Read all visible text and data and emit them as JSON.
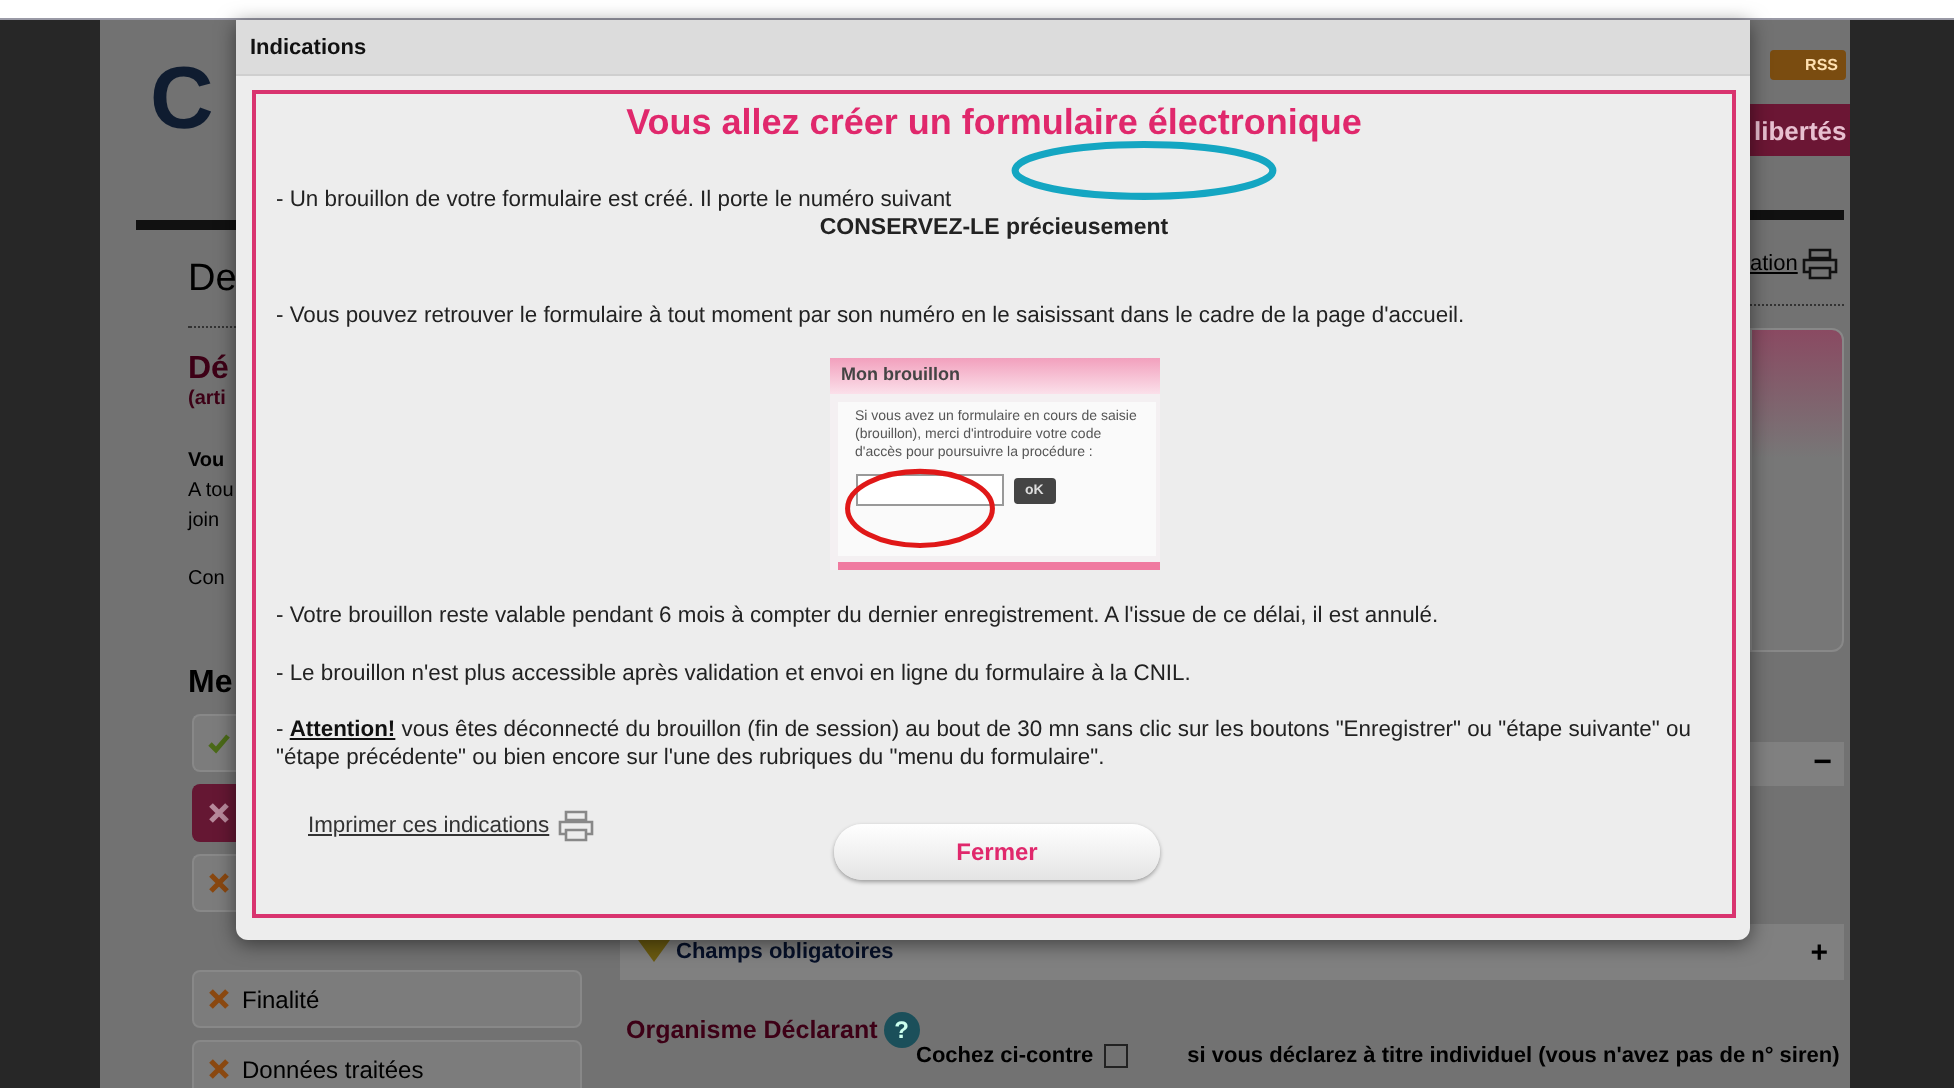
{
  "background_page": {
    "logo_fragment": "C",
    "rss_badge": "RSS",
    "banner_fragment": "libertés",
    "page_title_fragment": "De",
    "print_link_fragment": "ation",
    "section_title_fragment": "Dé",
    "section_subtitle_fragment": "(arti",
    "text_fragments": [
      {
        "text": "Vou",
        "kind": "bold"
      },
      {
        "text": "A tou",
        "kind": "plain"
      },
      {
        "text": "join",
        "kind": "plain"
      },
      {
        "text": "Con",
        "kind": "plain"
      }
    ],
    "menu_title_fragment": "Me",
    "menu_items": [
      {
        "kind": "done",
        "selected": false
      },
      {
        "kind": "todo",
        "selected": true
      },
      {
        "kind": "todo",
        "selected": false
      },
      {
        "label": "Finalité",
        "kind": "todo",
        "selected": false
      },
      {
        "label": "Données traitées",
        "kind": "todo",
        "selected": false
      }
    ],
    "collapsed_panel": {
      "toggle": "−"
    },
    "required_panel": {
      "label": "Champs obligatoires",
      "toggle": "+"
    },
    "declarant": {
      "title": "Organisme Déclarant",
      "help_glyph": "?",
      "checkbox_label": "Cochez ci-contre",
      "checked": false,
      "hint": "si vous déclarez à titre individuel (vous n'avez pas de n° siren)"
    }
  },
  "dialog": {
    "title": "Indications",
    "heading": "Vous allez créer un formulaire électronique",
    "draft_line": "- Un brouillon de votre formulaire est créé. Il porte le numéro suivant",
    "keep_line": "CONSERVEZ-LE précieusement",
    "retrieve_line": "- Vous pouvez retrouver le formulaire à tout moment par son numéro en le saisissant dans le cadre de la page d'accueil.",
    "example": {
      "title": "Mon brouillon",
      "text": "Si vous avez un formulaire en cours de saisie (brouillon), merci d'introduire votre code d'accès pour poursuivre la procédure :",
      "button": "oK"
    },
    "notes": [
      "- Votre brouillon reste valable pendant 6 mois à compter du dernier enregistrement. A l'issue de ce délai, il est annulé.",
      "- Le brouillon n'est plus accessible après validation et envoi en ligne du formulaire à la CNIL.",
      "- **Attention!** vous êtes déconnecté du brouillon (fin de session) au bout de 30 mn sans clic sur les boutons \"Enregistrer\" ou \"étape suivante\" ou \"étape précédente\" ou bien encore sur l'une des rubriques du \"menu du formulaire\"."
    ],
    "print_link": "Imprimer ces indications",
    "close_button": "Fermer"
  }
}
